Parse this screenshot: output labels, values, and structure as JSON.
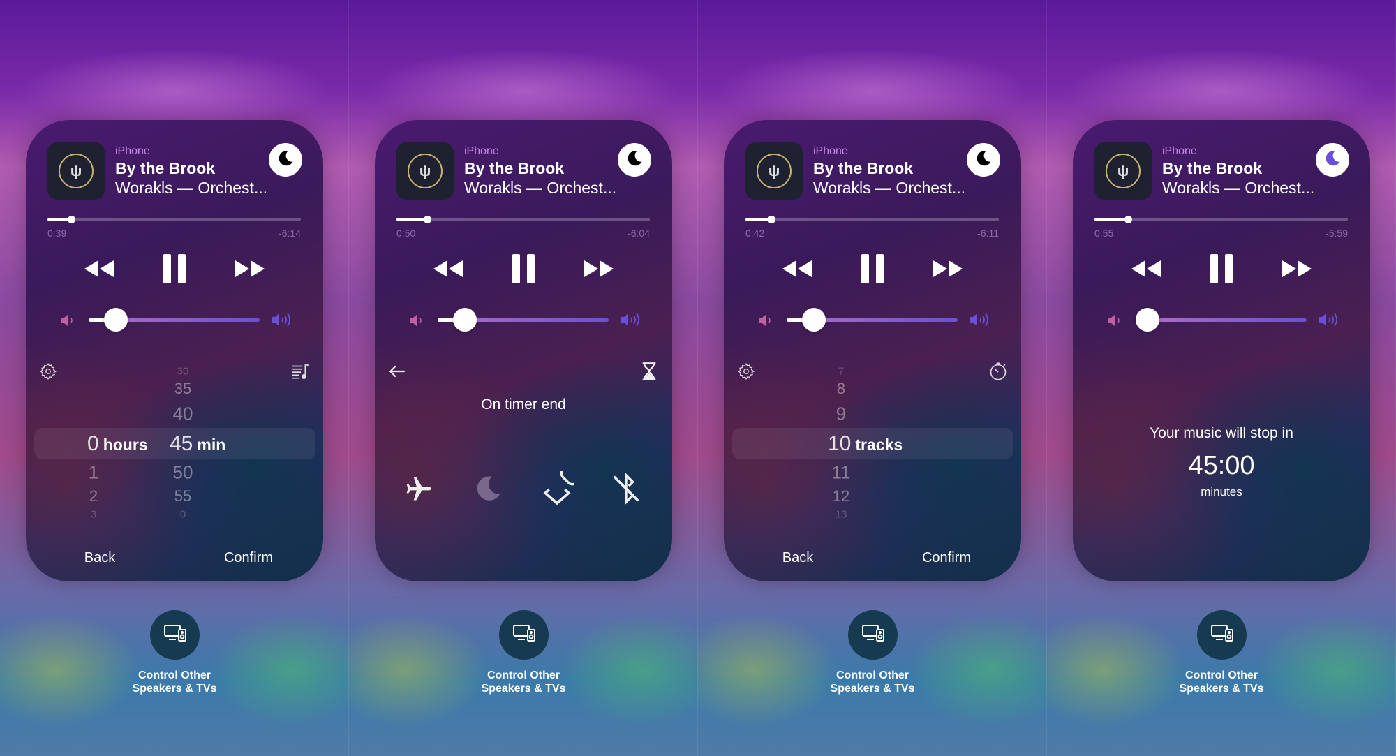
{
  "panels": [
    {
      "source": "iPhone",
      "title": "By the Brook",
      "subtitle": "Worakls — Orchest...",
      "elapsed": "0:39",
      "remaining": "-6:14",
      "progress": 0.094,
      "volume": 0.16,
      "sleep_icon_color": "#000000",
      "mode": "picker",
      "left_icon": "gear-icon",
      "right_icon": "playlist-music-icon",
      "columns": [
        {
          "above": [
            "",
            "",
            ""
          ],
          "selected": "0",
          "unit": "hours",
          "below": [
            "1",
            "2",
            "3"
          ]
        },
        {
          "above": [
            "30",
            "35",
            "40"
          ],
          "selected": "45",
          "unit": "min",
          "below": [
            "50",
            "55",
            "0"
          ]
        }
      ],
      "back": "Back",
      "confirm": "Confirm"
    },
    {
      "source": "iPhone",
      "title": "By the Brook",
      "subtitle": "Worakls — Orchest...",
      "elapsed": "0:50",
      "remaining": "-6:04",
      "progress": 0.121,
      "volume": 0.16,
      "sleep_icon_color": "#000000",
      "mode": "actions",
      "left_icon": "back-arrow-icon",
      "right_icon": "hourglass-icon",
      "heading": "On timer end",
      "actions": [
        {
          "icon": "airplane-icon",
          "active": true
        },
        {
          "icon": "moon-icon",
          "active": false
        },
        {
          "icon": "shortcuts-icon",
          "active": true
        },
        {
          "icon": "bluetooth-off-icon",
          "active": true
        }
      ]
    },
    {
      "source": "iPhone",
      "title": "By the Brook",
      "subtitle": "Worakls — Orchest...",
      "elapsed": "0:42",
      "remaining": "-6:11",
      "progress": 0.102,
      "volume": 0.16,
      "sleep_icon_color": "#000000",
      "mode": "picker",
      "left_icon": "gear-icon",
      "right_icon": "stopwatch-icon",
      "columns": [
        {
          "above": [
            "7",
            "8",
            "9"
          ],
          "selected": "10",
          "unit": "tracks",
          "below": [
            "11",
            "12",
            "13"
          ]
        }
      ],
      "back": "Back",
      "confirm": "Confirm"
    },
    {
      "source": "iPhone",
      "title": "By the Brook",
      "subtitle": "Worakls — Orchest...",
      "elapsed": "0:55",
      "remaining": "-5:59",
      "progress": 0.133,
      "volume": 0.0,
      "sleep_icon_color": "#6a50d8",
      "mode": "countdown",
      "message": "Your music will stop in",
      "time": "45:00",
      "unit": "minutes"
    }
  ],
  "other_devices": {
    "line1": "Control Other",
    "line2": "Speakers & TVs",
    "icon": "tv-speaker-icon"
  },
  "colors": {
    "accent": "#c98ae8",
    "volume_low": "#c060a0",
    "volume_high": "#6a50d8"
  }
}
